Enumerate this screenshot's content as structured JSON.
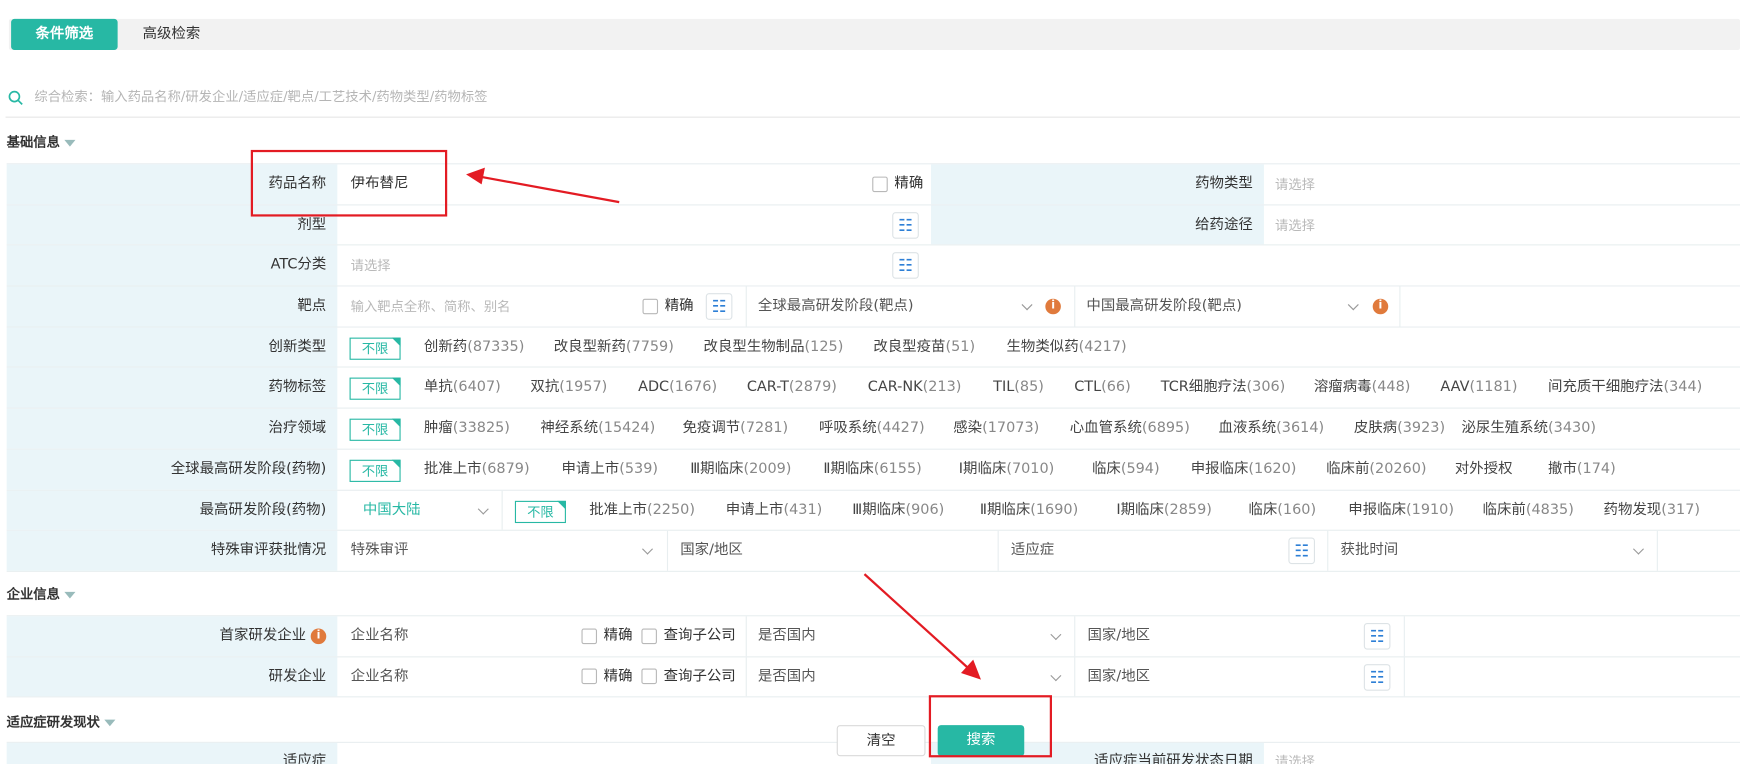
{
  "tabs": {
    "filter": "条件筛选",
    "advanced": "高级检索"
  },
  "search": {
    "placeholder": "综合检索：输入药品名称/研发企业/适应症/靶点/工艺技术/药物类型/药物标签"
  },
  "sections": {
    "basic": "基础信息",
    "company": "企业信息",
    "indication": "适应症研发现状"
  },
  "basic": {
    "drug_name": {
      "label": "药品名称",
      "value": "伊布替尼",
      "exact": "精确"
    },
    "drug_type": {
      "label": "药物类型",
      "placeholder": "请选择"
    },
    "dosage_form": {
      "label": "剂型"
    },
    "route": {
      "label": "给药途径",
      "placeholder": "请选择"
    },
    "atc": {
      "label": "ATC分类",
      "placeholder": "请选择"
    },
    "target": {
      "label": "靶点",
      "placeholder": "输入靶点全称、简称、别名",
      "exact": "精确",
      "global_stage": "全球最高研发阶段(靶点)",
      "china_stage": "中国最高研发阶段(靶点)"
    },
    "innovation": {
      "label": "创新类型",
      "options": [
        [
          "创新药",
          "(87335)"
        ],
        [
          "改良型新药",
          "(7759)"
        ],
        [
          "改良型生物制品",
          "(125)"
        ],
        [
          "改良型疫苗",
          "(51)"
        ],
        [
          "生物类似药",
          "(4217)"
        ]
      ]
    },
    "tags": {
      "label": "药物标签",
      "options": [
        [
          "单抗",
          "(6407)"
        ],
        [
          "双抗",
          "(1957)"
        ],
        [
          "ADC",
          "(1676)"
        ],
        [
          "CAR-T",
          "(2879)"
        ],
        [
          "CAR-NK",
          "(213)"
        ],
        [
          "TIL",
          "(85)"
        ],
        [
          "CTL",
          "(66)"
        ],
        [
          "TCR细胞疗法",
          "(306)"
        ],
        [
          "溶瘤病毒",
          "(448)"
        ],
        [
          "AAV",
          "(1181)"
        ],
        [
          "间充质干细胞疗法",
          "(344)"
        ]
      ]
    },
    "therapy": {
      "label": "治疗领域",
      "options": [
        [
          "肿瘤",
          "(33825)"
        ],
        [
          "神经系统",
          "(15424)"
        ],
        [
          "免疫调节",
          "(7281)"
        ],
        [
          "呼吸系统",
          "(4427)"
        ],
        [
          "感染",
          "(17073)"
        ],
        [
          "心血管系统",
          "(6895)"
        ],
        [
          "血液系统",
          "(3614)"
        ],
        [
          "皮肤病",
          "(3923)"
        ],
        [
          "泌尿生殖系统",
          "(3430)"
        ]
      ]
    },
    "global_stage": {
      "label": "全球最高研发阶段(药物)",
      "options": [
        [
          "批准上市",
          "(6879)"
        ],
        [
          "申请上市",
          "(539)"
        ],
        [
          "Ⅲ期临床",
          "(2009)"
        ],
        [
          "Ⅱ期临床",
          "(6155)"
        ],
        [
          "Ⅰ期临床",
          "(7010)"
        ],
        [
          "临床",
          "(594)"
        ],
        [
          "申报临床",
          "(1620)"
        ],
        [
          "临床前",
          "(20260)"
        ],
        [
          "对外授权",
          ""
        ],
        [
          "撤市",
          "(174)"
        ]
      ]
    },
    "highest_stage": {
      "label": "最高研发阶段(药物)",
      "region": "中国大陆",
      "options": [
        [
          "批准上市",
          "(2250)"
        ],
        [
          "申请上市",
          "(431)"
        ],
        [
          "Ⅲ期临床",
          "(906)"
        ],
        [
          "Ⅱ期临床",
          "(1690)"
        ],
        [
          "Ⅰ期临床",
          "(2859)"
        ],
        [
          "临床",
          "(160)"
        ],
        [
          "申报临床",
          "(1910)"
        ],
        [
          "临床前",
          "(4835)"
        ],
        [
          "药物发现",
          "(317)"
        ]
      ]
    },
    "special": {
      "label": "特殊审评获批情况",
      "review": "特殊审评",
      "country": "国家/地区",
      "indication": "适应症",
      "approval_time": "获批时间"
    },
    "nolimit": "不限"
  },
  "company": {
    "first": {
      "label": "首家研发企业",
      "placeholder": "企业名称",
      "exact": "精确",
      "subsidiary": "查询子公司",
      "domestic": "是否国内",
      "country": "国家/地区"
    },
    "dev": {
      "label": "研发企业",
      "placeholder": "企业名称",
      "exact": "精确",
      "subsidiary": "查询子公司",
      "domestic": "是否国内",
      "country": "国家/地区"
    }
  },
  "indication": {
    "label": "适应症",
    "latest_date": "适应症当前研发状态日期",
    "placeholder": "请选择"
  },
  "buttons": {
    "clear": "清空",
    "search": "搜索"
  },
  "colors": {
    "accent": "#27b8a4",
    "label_bg": "#eaf5f9",
    "annotation": "#e31b23",
    "tree_icon": "#2d7fd6",
    "info": "#e07a3c"
  },
  "icons": [
    "search-icon",
    "tree-icon",
    "chevron-down-icon",
    "info-icon",
    "caret-down-icon"
  ]
}
